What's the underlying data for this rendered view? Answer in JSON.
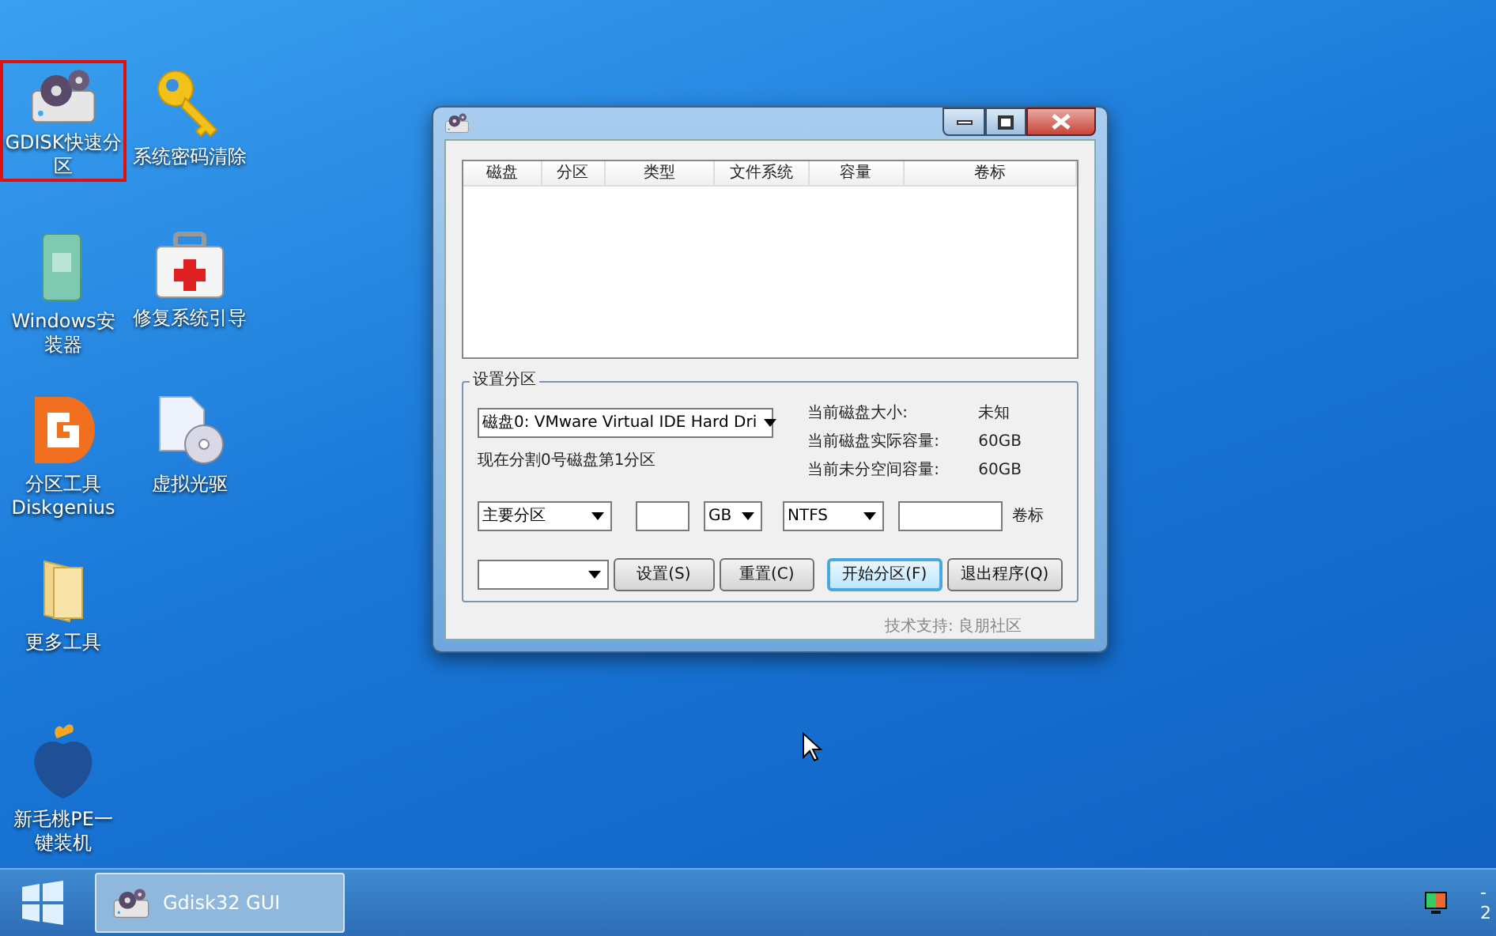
{
  "desktop_icons": [
    {
      "label": "GDISK快速分区",
      "selected": true
    },
    {
      "label": "Windows安装器",
      "selected": false
    },
    {
      "label": "分区工具 Diskgenius",
      "selected": false
    },
    {
      "label": "更多工具",
      "selected": false
    },
    {
      "label": "新毛桃PE一键装机",
      "selected": false
    },
    {
      "label": "系统密码清除",
      "selected": false
    },
    {
      "label": "修复系统引导",
      "selected": false
    },
    {
      "label": "虚拟光驱",
      "selected": false
    }
  ],
  "window": {
    "table": {
      "columns": [
        "磁盘",
        "分区",
        "类型",
        "文件系统",
        "容量",
        "卷标"
      ]
    },
    "group": {
      "title": "设置分区",
      "disk_select": "磁盘0: VMware Virtual IDE Hard Dri",
      "status": "现在分割0号磁盘第1分区",
      "info": [
        {
          "label": "当前磁盘大小:",
          "value": "未知"
        },
        {
          "label": "当前磁盘实际容量:",
          "value": "60GB"
        },
        {
          "label": "当前未分空间容量:",
          "value": "60GB"
        }
      ],
      "partition_type": "主要分区",
      "unit": "GB",
      "filesystem": "NTFS",
      "volume_label": "卷标",
      "buttons": [
        {
          "label": "设置(S)",
          "focused": false
        },
        {
          "label": "重置(C)",
          "focused": false
        },
        {
          "label": "开始分区(F)",
          "focused": true
        },
        {
          "label": "退出程序(Q)",
          "focused": false
        }
      ]
    },
    "footer": "技术支持: 良朋社区"
  },
  "taskbar": {
    "tasks": [
      {
        "label": "Gdisk32 GUI",
        "selected": true
      }
    ],
    "clock": [
      "-",
      "2"
    ]
  }
}
